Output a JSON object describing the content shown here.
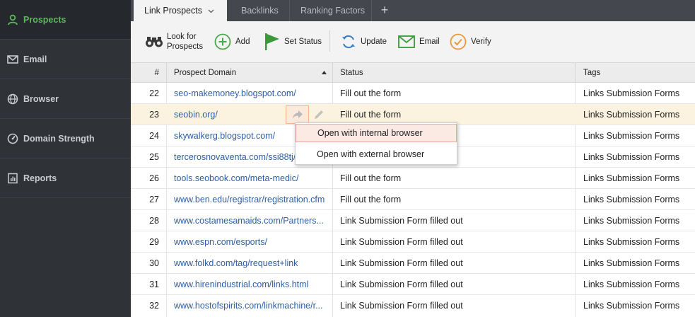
{
  "colors": {
    "accent_green": "#5cb85c",
    "link_blue": "#2d5ea8",
    "sidebar_bg": "#2f3237",
    "selected_row": "#fbf3df"
  },
  "sidebar": {
    "items": [
      {
        "label": "Prospects",
        "icon": "person-icon"
      },
      {
        "label": "Email",
        "icon": "envelope-icon"
      },
      {
        "label": "Browser",
        "icon": "globe-icon"
      },
      {
        "label": "Domain Strength",
        "icon": "gauge-icon"
      },
      {
        "label": "Reports",
        "icon": "report-icon"
      }
    ]
  },
  "tabs": [
    {
      "label": "Link Prospects"
    },
    {
      "label": "Backlinks"
    },
    {
      "label": "Ranking Factors"
    }
  ],
  "toolbar": {
    "look_for_line1": "Look for",
    "look_for_line2": "Prospects",
    "add": "Add",
    "set_status": "Set Status",
    "update": "Update",
    "email": "Email",
    "verify": "Verify"
  },
  "table": {
    "headers": {
      "num": "#",
      "domain": "Prospect Domain",
      "status": "Status",
      "tags": "Tags"
    },
    "rows": [
      {
        "num": "22",
        "domain": "seo-makemoney.blogspot.com/",
        "status": "Fill out the form",
        "tags": "Links Submission Forms"
      },
      {
        "num": "23",
        "domain": "seobin.org/",
        "status": "Fill out the form",
        "tags": "Links Submission Forms"
      },
      {
        "num": "24",
        "domain": "skywalkerg.blogspot.com/",
        "status": "",
        "tags": "Links Submission Forms"
      },
      {
        "num": "25",
        "domain": "tercerosnovaventa.com/ssi88tj/l",
        "status": "",
        "tags": "Links Submission Forms"
      },
      {
        "num": "26",
        "domain": "tools.seobook.com/meta-medic/",
        "status": "Fill out the form",
        "tags": "Links Submission Forms"
      },
      {
        "num": "27",
        "domain": "www.ben.edu/registrar/registration.cfm",
        "status": "Fill out the form",
        "tags": "Links Submission Forms"
      },
      {
        "num": "28",
        "domain": "www.costamesamaids.com/Partners...",
        "status": "Link Submission Form filled out",
        "tags": "Links Submission Forms"
      },
      {
        "num": "29",
        "domain": "www.espn.com/esports/",
        "status": "Link Submission Form filled out",
        "tags": "Links Submission Forms"
      },
      {
        "num": "30",
        "domain": "www.folkd.com/tag/request+link",
        "status": "Link Submission Form filled out",
        "tags": "Links Submission Forms"
      },
      {
        "num": "31",
        "domain": "www.hirenindustrial.com/links.html",
        "status": "Link Submission Form filled out",
        "tags": "Links Submission Forms"
      },
      {
        "num": "32",
        "domain": "www.hostofspirits.com/linkmachine/r...",
        "status": "Link Submission Form filled out",
        "tags": "Links Submission Forms"
      }
    ]
  },
  "context_menu": {
    "items": [
      {
        "label": "Open with internal browser"
      },
      {
        "label": "Open with external browser"
      }
    ]
  }
}
